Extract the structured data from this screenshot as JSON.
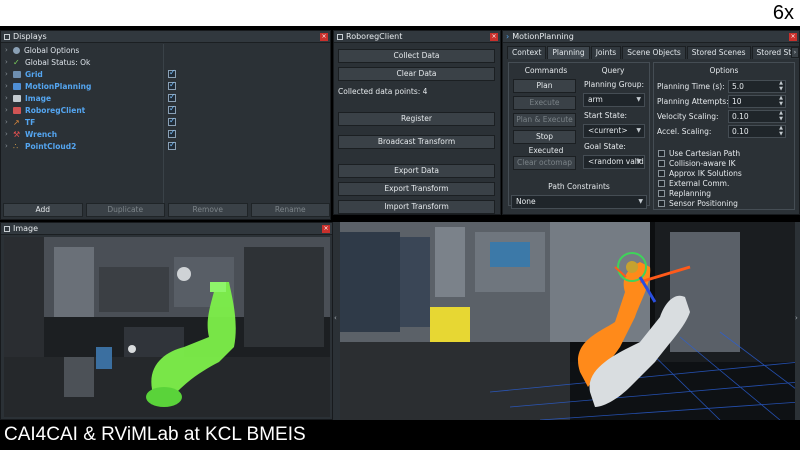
{
  "overlay": {
    "speed": "6x",
    "caption": "CAI4CAI & RViMLab at KCL BMEIS"
  },
  "displays": {
    "title": "Displays",
    "items": [
      {
        "label": "Global Options",
        "icon": "gear-icon",
        "checked": false,
        "blue": false
      },
      {
        "label": "Global Status: Ok",
        "icon": "check-icon",
        "checked": false,
        "blue": false
      },
      {
        "label": "Grid",
        "icon": "grid-icon",
        "checked": true,
        "blue": true
      },
      {
        "label": "MotionPlanning",
        "icon": "motion-planning-icon",
        "checked": true,
        "blue": true
      },
      {
        "label": "Image",
        "icon": "image-icon",
        "checked": true,
        "blue": true
      },
      {
        "label": "RoboregClient",
        "icon": "plugin-icon",
        "checked": true,
        "blue": true
      },
      {
        "label": "TF",
        "icon": "tf-icon",
        "checked": true,
        "blue": true
      },
      {
        "label": "Wrench",
        "icon": "wrench-icon",
        "checked": true,
        "blue": true
      },
      {
        "label": "PointCloud2",
        "icon": "pointcloud-icon",
        "checked": true,
        "blue": true
      }
    ],
    "buttons": {
      "add": "Add",
      "duplicate": "Duplicate",
      "remove": "Remove",
      "rename": "Rename"
    }
  },
  "roboreg": {
    "title": "RoboregClient",
    "collect": "Collect Data",
    "clear": "Clear Data",
    "collected": "Collected data points: 4",
    "register": "Register",
    "broadcast": "Broadcast Transform",
    "export_data": "Export Data",
    "export_transform": "Export Transform",
    "import_transform": "Import Transform"
  },
  "motion": {
    "title": "MotionPlanning",
    "tabs": [
      "Context",
      "Planning",
      "Joints",
      "Scene Objects",
      "Stored Scenes",
      "Stored States"
    ],
    "active_tab": "Planning",
    "commands": {
      "title": "Commands",
      "plan": "Plan",
      "execute": "Execute",
      "plan_execute": "Plan & Execute",
      "stop": "Stop",
      "status": "Executed",
      "clear_octomap": "Clear octomap"
    },
    "query": {
      "title": "Query",
      "group_label": "Planning Group:",
      "group_value": "arm",
      "start_label": "Start State:",
      "start_value": "<current>",
      "goal_label": "Goal State:",
      "goal_value": "<random valid>"
    },
    "options": {
      "title": "Options",
      "planning_time_label": "Planning Time (s):",
      "planning_time": "5.0",
      "attempts_label": "Planning Attempts:",
      "attempts": "10",
      "velocity_label": "Velocity Scaling:",
      "velocity": "0.10",
      "accel_label": "Accel. Scaling:",
      "accel": "0.10",
      "checks": [
        "Use Cartesian Path",
        "Collision-aware IK",
        "Approx IK Solutions",
        "External Comm.",
        "Replanning",
        "Sensor Positioning"
      ]
    },
    "constraints": {
      "title": "Path Constraints",
      "value": "None"
    }
  },
  "image_panel": {
    "title": "Image"
  },
  "colors": {
    "accent_blue": "#54a5f0",
    "close_red": "#c9302c",
    "panel_bg": "#2b3136",
    "robot_green": "#7df04a",
    "robot_orange": "#ff8a1a"
  }
}
